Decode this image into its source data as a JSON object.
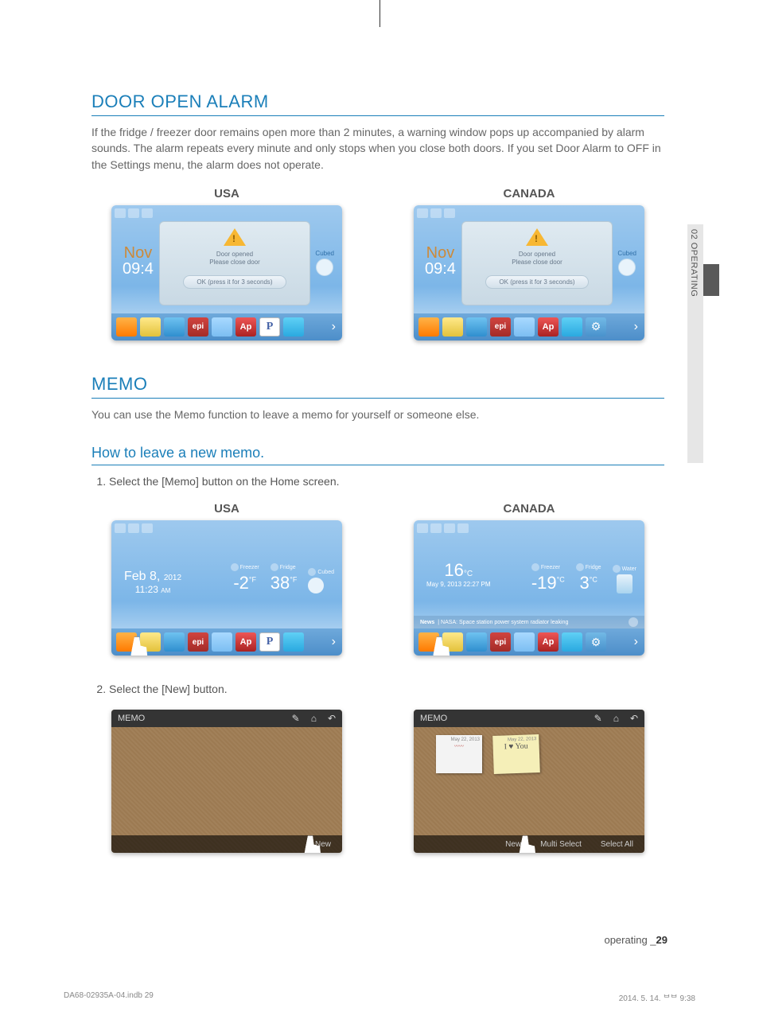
{
  "side_tab": "02  OPERATING",
  "section1": {
    "title": "DOOR OPEN ALARM",
    "body": "If the fridge / freezer door remains open more than 2 minutes, a warning window pops up accompanied by alarm sounds. The alarm repeats every minute and only stops when you close both doors. If you set Door Alarm to OFF in the Settings menu, the alarm does not operate."
  },
  "labels": {
    "usa": "USA",
    "canada": "CANADA"
  },
  "alarm_modal": {
    "line1": "Door opened",
    "line2": "Please close door",
    "ok": "OK (press it for 3 seconds)"
  },
  "date_widget": {
    "month": "Nov",
    "day_time": "09:4"
  },
  "ice": {
    "label": "Cubed"
  },
  "dock_apps": {
    "usa": [
      "Memo",
      "Photos",
      "GroceryMgr",
      "Epicurious",
      "Calendar",
      "AP News",
      "Pandora",
      "Twitter"
    ],
    "canada": [
      "Memo",
      "Photos",
      "GroceryMgr",
      "Epicurious",
      "Calendar",
      "AP News",
      "Twitter",
      "Settings"
    ]
  },
  "section2": {
    "title": "MEMO",
    "body": "You can use the Memo function to leave a memo for yourself or someone else.",
    "sub": "How to leave a new memo.",
    "step1": "Select the [Memo] button on the Home screen.",
    "step2": "Select the [New] button."
  },
  "home_usa": {
    "date": "Feb 8,",
    "year": "2012",
    "time": "11:23",
    "ampm": "AM",
    "freezer_label": "Freezer",
    "freezer": "-2",
    "freezer_unit": "°F",
    "fridge_label": "Fridge",
    "fridge": "38",
    "fridge_unit": "°F",
    "cubed_label": "Cubed"
  },
  "home_can": {
    "temp_main": "16",
    "temp_main_unit": "°C",
    "date": "May 9, 2013 22:27",
    "ampm": "PM",
    "freezer_label": "Freezer",
    "freezer": "-19",
    "freezer_unit": "°C",
    "fridge_label": "Fridge",
    "fridge": "3",
    "fridge_unit": "°C",
    "water_label": "Water",
    "news_prefix": "News",
    "news": "| NASA: Space station power system radiator leaking"
  },
  "memo_board": {
    "title": "MEMO",
    "new": "New",
    "multi": "Multi Select",
    "select_all": "Select All",
    "note_date": "May 22, 2013",
    "note_text": "I ♥ You"
  },
  "footer": {
    "text_prefix": "operating _",
    "page": "29"
  },
  "indd": {
    "file": "DA68-02935A-04.indb   29",
    "stamp": "2014. 5. 14.   ᄇᄇ 9:38"
  }
}
